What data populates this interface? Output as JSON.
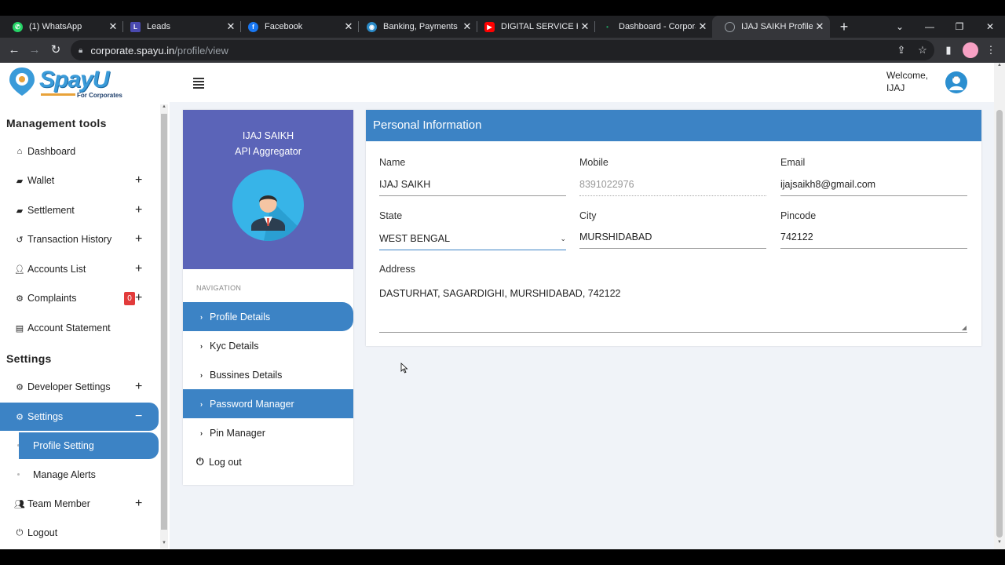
{
  "browser": {
    "tabs": [
      {
        "title": "(1) WhatsApp",
        "icon": "whatsapp-icon",
        "color": "#25d366"
      },
      {
        "title": "Leads",
        "icon": "leads-icon",
        "color": "#4a4ab0"
      },
      {
        "title": "Facebook",
        "icon": "facebook-icon",
        "color": "#1877f2"
      },
      {
        "title": "Banking, Payments &",
        "icon": "banking-icon",
        "color": "#2a8ac7"
      },
      {
        "title": "DIGITAL SERVICE HUB",
        "icon": "youtube-icon",
        "color": "#ff0000"
      },
      {
        "title": "Dashboard - Corpora",
        "icon": "dashboard-tab-icon",
        "color": "#1fa463"
      },
      {
        "title": "IJAJ SAIKH Profile - Co",
        "icon": "globe-icon",
        "color": "#9aa0a6"
      }
    ],
    "url_host": "corporate.spayu.in",
    "url_path": "/profile/view"
  },
  "header": {
    "logo_text": "SpayU",
    "logo_sub": "For Corporates",
    "welcome_line1": "Welcome,",
    "welcome_line2": "IJAJ"
  },
  "sidebar": {
    "heading_tools": "Management tools",
    "heading_settings": "Settings",
    "items": {
      "dashboard": "Dashboard",
      "wallet": "Wallet",
      "settlement": "Settlement",
      "transaction_history": "Transaction History",
      "accounts_list": "Accounts List",
      "complaints": "Complaints",
      "complaints_badge": "0",
      "account_statement": "Account Statement",
      "developer_settings": "Developer Settings",
      "settings": "Settings",
      "profile_setting": "Profile Setting",
      "manage_alerts": "Manage Alerts",
      "team_member": "Team Member",
      "logout": "Logout"
    }
  },
  "profile": {
    "name": "IJAJ SAIKH",
    "role": "API Aggregator",
    "nav_label": "NAVIGATION",
    "nav": {
      "profile_details": "Profile Details",
      "kyc_details": "Kyc Details",
      "business_details": "Bussines Details",
      "password_manager": "Password Manager",
      "pin_manager": "Pin Manager",
      "logout": "Log out"
    }
  },
  "personal_info": {
    "title": "Personal Information",
    "name_label": "Name",
    "name": "IJAJ SAIKH",
    "mobile_label": "Mobile",
    "mobile": "8391022976",
    "email_label": "Email",
    "email": "ijajsaikh8@gmail.com",
    "state_label": "State",
    "state": "WEST BENGAL",
    "city_label": "City",
    "city": "MURSHIDABAD",
    "pincode_label": "Pincode",
    "pincode": "742122",
    "address_label": "Address",
    "address": "DASTURHAT, SAGARDIGHI, MURSHIDABAD, 742122"
  },
  "colors": {
    "accent": "#3c83c5",
    "profile_header": "#5b64b8",
    "badge": "#e23b3b"
  }
}
